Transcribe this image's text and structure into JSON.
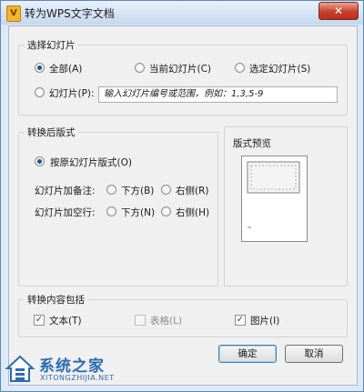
{
  "window": {
    "title": "转为WPS文字文档",
    "close_glyph": "✕",
    "app_icon_glyph": "V"
  },
  "select_slides": {
    "legend": "选择幻灯片",
    "all": "全部(A)",
    "current": "当前幻灯片(C)",
    "selected": "选定幻灯片(S)",
    "slides": "幻灯片(P):",
    "range_placeholder": "输入幻灯片编号或范围，例如：1,3,5-9"
  },
  "layout": {
    "legend": "转换后版式",
    "original": "按原幻灯片版式(O)",
    "notes_label": "幻灯片加备注:",
    "notes_below": "下方(B)",
    "notes_right": "右侧(R)",
    "blank_label": "幻灯片加空行:",
    "blank_below": "下方(N)",
    "blank_right": "右侧(H)"
  },
  "preview": {
    "title": "版式预览"
  },
  "content": {
    "legend": "转换内容包括",
    "text": "文本(T)",
    "table": "表格(L)",
    "image": "图片(I)",
    "text_checked": true,
    "table_checked": false,
    "image_checked": true
  },
  "buttons": {
    "ok": "确定",
    "cancel": "取消"
  },
  "watermark": {
    "name": "系统之家",
    "url": "XITONGZHIJIA.NET"
  },
  "colors": {
    "title_bar": "#c6d8ef",
    "close_button": "#c6402a",
    "frame": "#dfe9f6",
    "client": "#f0f0f0"
  }
}
